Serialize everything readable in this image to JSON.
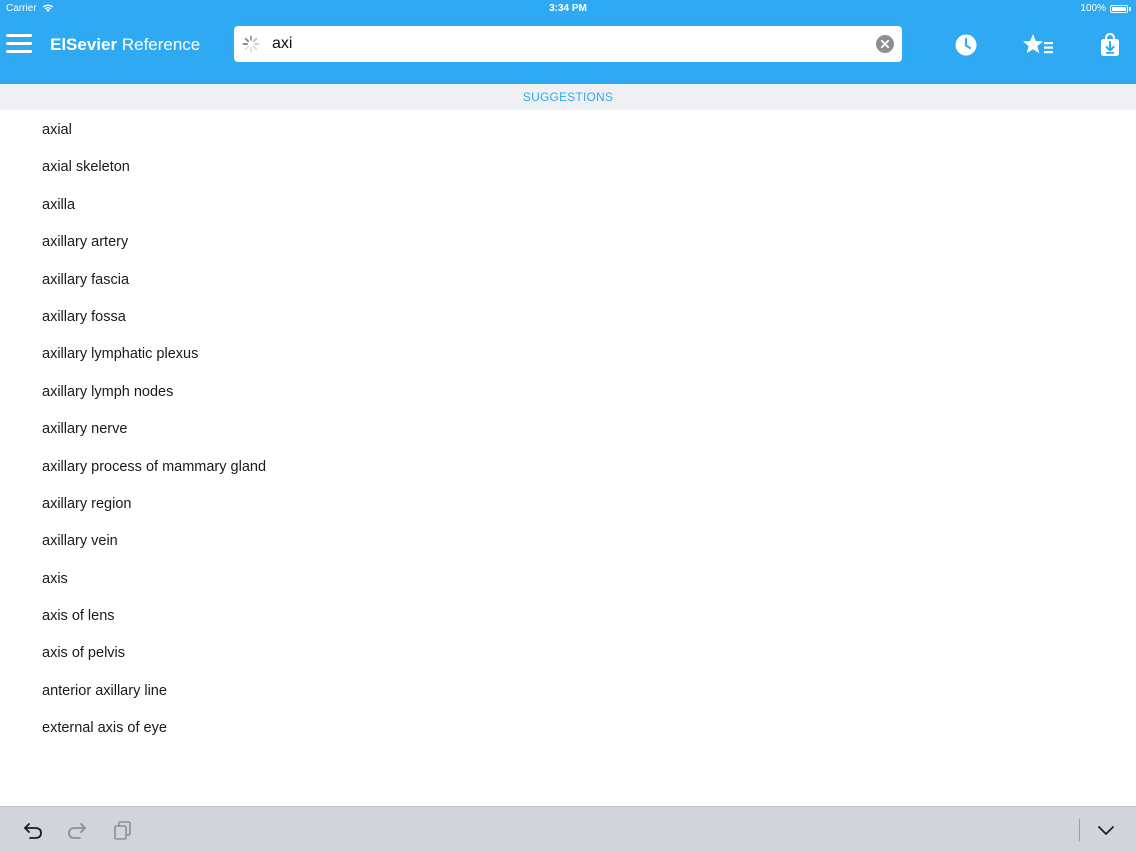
{
  "status_bar": {
    "carrier": "Carrier",
    "time": "3:34 PM",
    "battery": "100%"
  },
  "header": {
    "brand": "ElSevier",
    "title_suffix": " Reference",
    "search": {
      "value": "axi",
      "placeholder": ""
    },
    "actions": [
      "history-icon",
      "favorites-icon",
      "download-icon"
    ]
  },
  "suggestions": {
    "header": "SUGGESTIONS",
    "items": [
      "axial",
      "axial skeleton",
      "axilla",
      "axillary artery",
      "axillary fascia",
      "axillary fossa",
      "axillary lymphatic plexus",
      "axillary lymph nodes",
      "axillary nerve",
      "axillary process of mammary gland",
      "axillary region",
      "axillary vein",
      "axis",
      "axis of lens",
      "axis of pelvis",
      "anterior axillary line",
      "external axis of eye"
    ]
  },
  "keyboard_toolbar": {
    "icons": [
      "undo-icon",
      "redo-icon",
      "paste-icon",
      "dismiss-keyboard-icon"
    ]
  },
  "colors": {
    "accent": "#2fa9f1",
    "section_bg": "#eef0f3",
    "toolbar_bg": "#d1d4da"
  }
}
